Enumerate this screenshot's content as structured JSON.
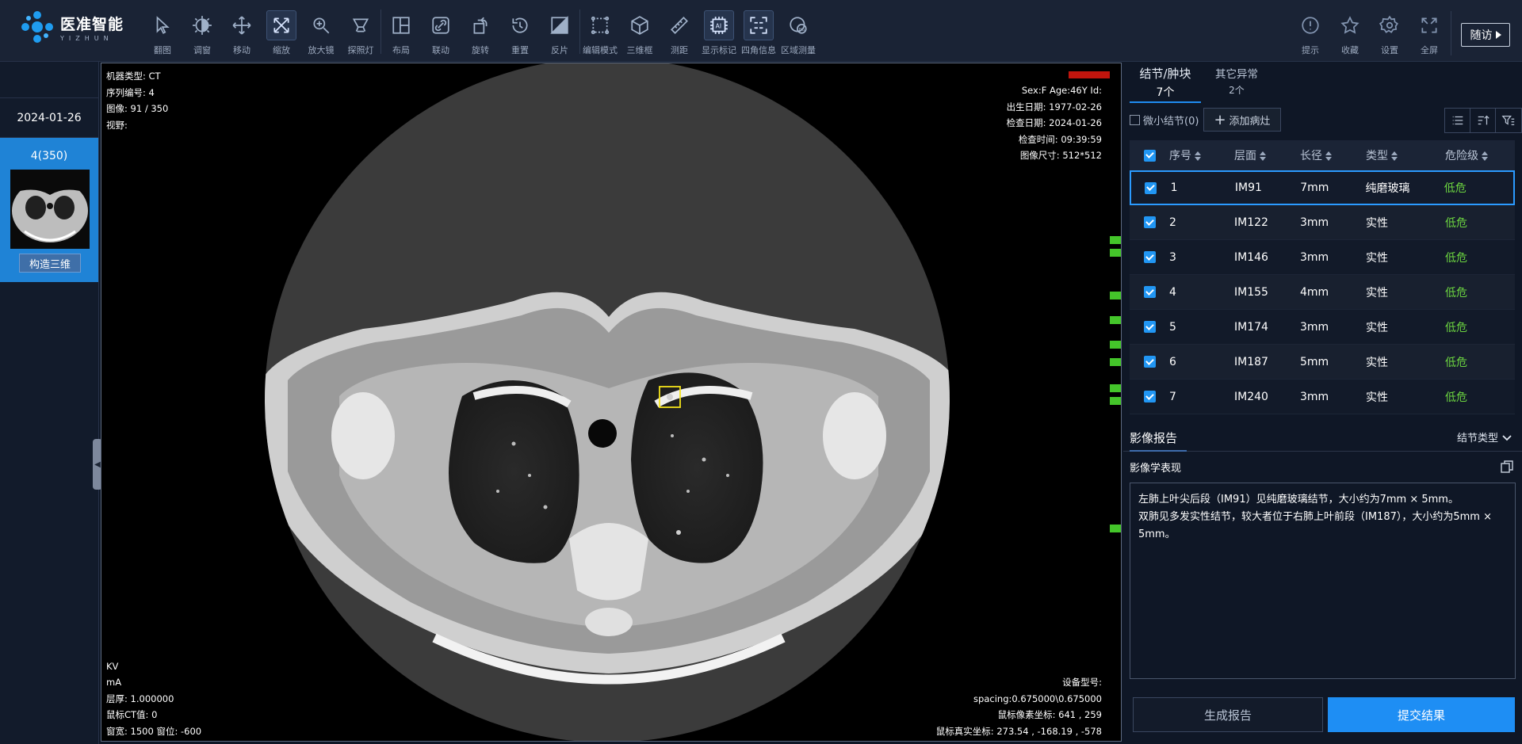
{
  "brand": {
    "name_cn": "医准智能",
    "name_en": "YIZHUN"
  },
  "toolbar": {
    "tools": [
      {
        "label": "翻图",
        "icon": "pointer-icon",
        "active": false
      },
      {
        "label": "调窗",
        "icon": "contrast-icon",
        "active": false
      },
      {
        "label": "移动",
        "icon": "move-icon",
        "active": false
      },
      {
        "label": "缩放",
        "icon": "zoom-expand-icon",
        "active": true
      },
      {
        "label": "放大镜",
        "icon": "magnifier-icon",
        "active": false
      },
      {
        "label": "探照灯",
        "icon": "spotlight-icon",
        "active": false
      },
      {
        "label": "布局",
        "icon": "layout-icon",
        "active": false
      },
      {
        "label": "联动",
        "icon": "link-icon",
        "active": false
      },
      {
        "label": "旋转",
        "icon": "rotate-icon",
        "active": false
      },
      {
        "label": "重置",
        "icon": "reset-icon",
        "active": false
      },
      {
        "label": "反片",
        "icon": "invert-icon",
        "active": false
      },
      {
        "label": "编辑模式",
        "icon": "edit-mode-icon",
        "active": false
      },
      {
        "label": "三维框",
        "icon": "cube-icon",
        "active": false
      },
      {
        "label": "测距",
        "icon": "ruler-icon",
        "active": false
      },
      {
        "label": "显示标记",
        "icon": "ai-mark-icon",
        "active": true
      },
      {
        "label": "四角信息",
        "icon": "corner-info-icon",
        "active": true
      },
      {
        "label": "区域测量",
        "icon": "region-measure-icon",
        "active": false
      }
    ],
    "right_tools": [
      {
        "label": "提示",
        "icon": "alert-icon"
      },
      {
        "label": "收藏",
        "icon": "star-icon"
      },
      {
        "label": "设置",
        "icon": "gear-icon"
      },
      {
        "label": "全屏",
        "icon": "fullscreen-icon"
      }
    ],
    "visit_button": "随访"
  },
  "left_panel": {
    "study_date": "2024-01-26",
    "series_count": "4(350)",
    "build_3d": "构造三维"
  },
  "viewer": {
    "top_left": [
      "机器类型: CT",
      "序列编号: 4",
      "图像: 91 / 350",
      "视野:"
    ],
    "top_right": [
      "Sex:F Age:46Y Id:",
      "出生日期: 1977-02-26",
      "检查日期: 2024-01-26",
      "检查时间: 09:39:59",
      "图像尺寸: 512*512"
    ],
    "bottom_left": [
      "KV",
      "mA",
      "层厚: 1.000000",
      "鼠标CT值:  0",
      "窗宽: 1500 窗位: -600"
    ],
    "bottom_right": [
      "设备型号:",
      "spacing:0.675000\\0.675000",
      "鼠标像素坐标:   641 , 259",
      "鼠标真实坐标:   273.54 , -168.19 , -578"
    ]
  },
  "right_panel": {
    "tabs": [
      {
        "title": "结节/肿块",
        "count": "7个",
        "active": true
      },
      {
        "title": "其它异常",
        "count": "2个",
        "active": false
      }
    ],
    "micro_nodule": "微小结节(0)",
    "add_lesion": "添加病灶",
    "columns": [
      "序号",
      "层面",
      "长径",
      "类型",
      "危险级"
    ],
    "rows": [
      {
        "index": "1",
        "layer": "IM91",
        "size": "7mm",
        "type": "纯磨玻璃",
        "risk": "低危"
      },
      {
        "index": "2",
        "layer": "IM122",
        "size": "3mm",
        "type": "实性",
        "risk": "低危"
      },
      {
        "index": "3",
        "layer": "IM146",
        "size": "3mm",
        "type": "实性",
        "risk": "低危"
      },
      {
        "index": "4",
        "layer": "IM155",
        "size": "4mm",
        "type": "实性",
        "risk": "低危"
      },
      {
        "index": "5",
        "layer": "IM174",
        "size": "3mm",
        "type": "实性",
        "risk": "低危"
      },
      {
        "index": "6",
        "layer": "IM187",
        "size": "5mm",
        "type": "实性",
        "risk": "低危"
      },
      {
        "index": "7",
        "layer": "IM240",
        "size": "3mm",
        "type": "实性",
        "risk": "低危"
      }
    ],
    "report_title": "影像报告",
    "report_type": "结节类型",
    "findings_label": "影像学表现",
    "findings": [
      "左肺上叶尖后段（IM91）见纯磨玻璃结节，大小约为7mm × 5mm。",
      "双肺见多发实性结节，较大者位于右肺上叶前段（IM187），大小约为5mm × 5mm。"
    ],
    "generate_report": "生成报告",
    "submit": "提交结果"
  },
  "colors": {
    "accent": "#1e8ef4",
    "risk_low": "#6cd640",
    "marker": "#44c52a"
  }
}
